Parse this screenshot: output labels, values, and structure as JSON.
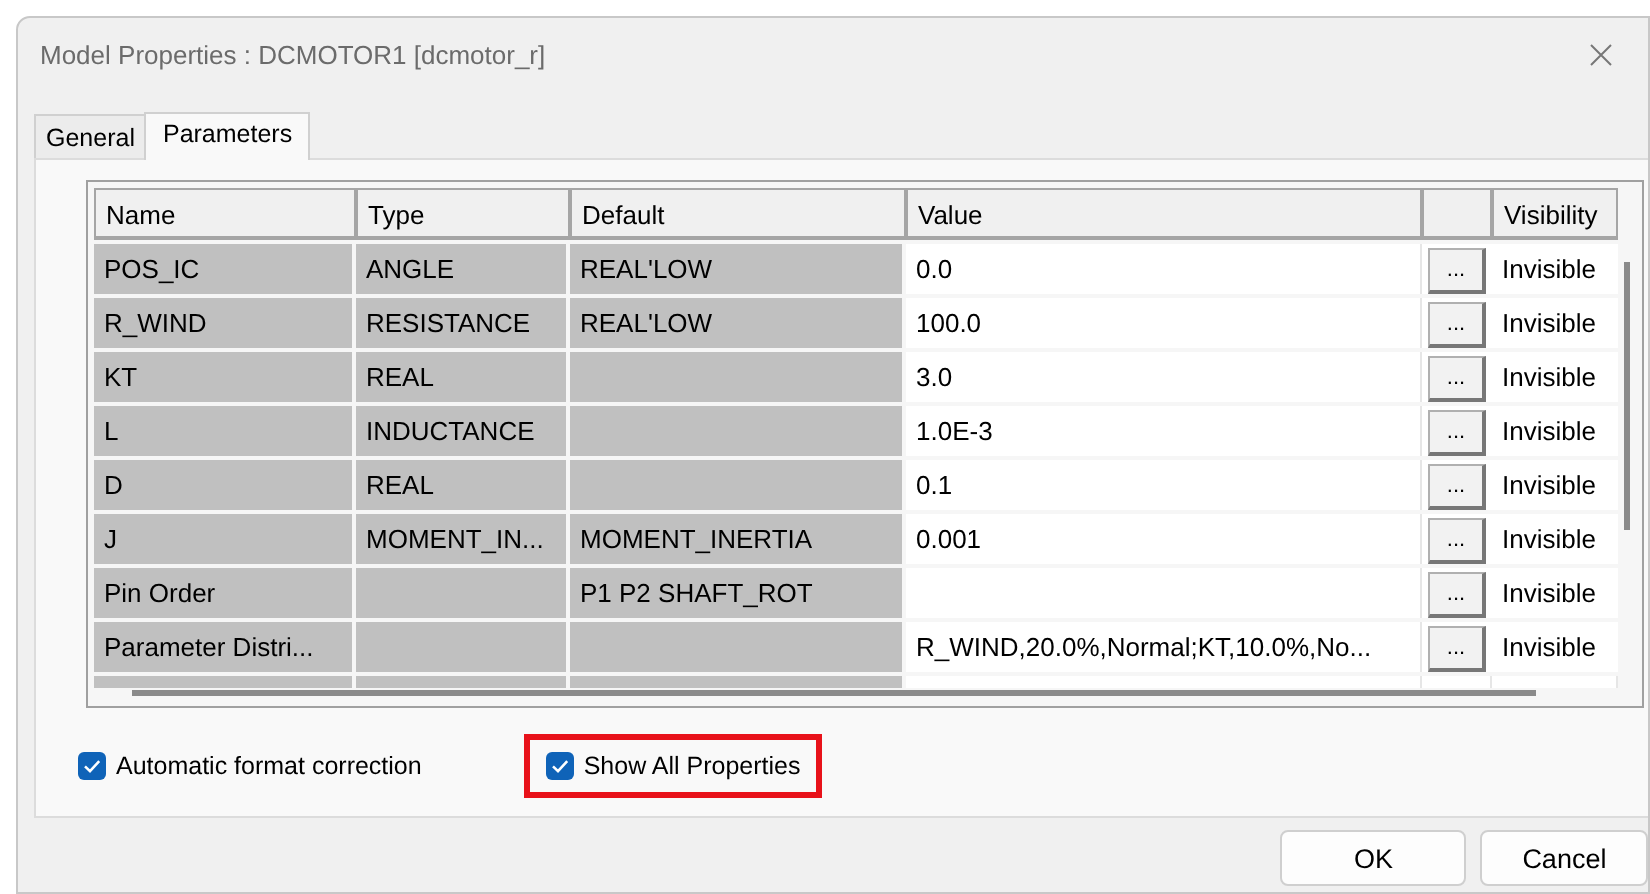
{
  "window": {
    "title": "Model Properties : DCMOTOR1 [dcmotor_r]"
  },
  "tabs": [
    {
      "label": "General",
      "selected": false
    },
    {
      "label": "Parameters",
      "selected": true
    }
  ],
  "table": {
    "columns": [
      "Name",
      "Type",
      "Default",
      "Value",
      "Visibility"
    ],
    "rows": [
      {
        "name": "POS_IC",
        "type": "ANGLE",
        "default": "REAL'LOW",
        "value": "0.0",
        "button": "...",
        "visibility": "Invisible"
      },
      {
        "name": "R_WIND",
        "type": "RESISTANCE",
        "default": "REAL'LOW",
        "value": "100.0",
        "button": "...",
        "visibility": "Invisible"
      },
      {
        "name": "KT",
        "type": "REAL",
        "default": "",
        "value": "3.0",
        "button": "...",
        "visibility": "Invisible"
      },
      {
        "name": "L",
        "type": "INDUCTANCE",
        "default": "",
        "value": "1.0E-3",
        "button": "...",
        "visibility": "Invisible"
      },
      {
        "name": "D",
        "type": "REAL",
        "default": "",
        "value": "0.1",
        "button": "...",
        "visibility": "Invisible"
      },
      {
        "name": "J",
        "type": "MOMENT_IN...",
        "default": "MOMENT_INERTIA",
        "value": "0.001",
        "button": "...",
        "visibility": "Invisible"
      },
      {
        "name": "Pin Order",
        "type": "",
        "default": "P1 P2 SHAFT_ROT",
        "value": "",
        "button": "...",
        "visibility": "Invisible"
      },
      {
        "name": "Parameter Distri...",
        "type": "",
        "default": "",
        "value": "R_WIND,20.0%,Normal;KT,10.0%,No...",
        "button": "...",
        "visibility": "Invisible"
      }
    ]
  },
  "options": [
    {
      "label": "Automatic format correction",
      "checked": true,
      "highlighted": false
    },
    {
      "label": "Show All Properties",
      "checked": true,
      "highlighted": true
    }
  ],
  "buttons": [
    "OK",
    "Cancel"
  ]
}
